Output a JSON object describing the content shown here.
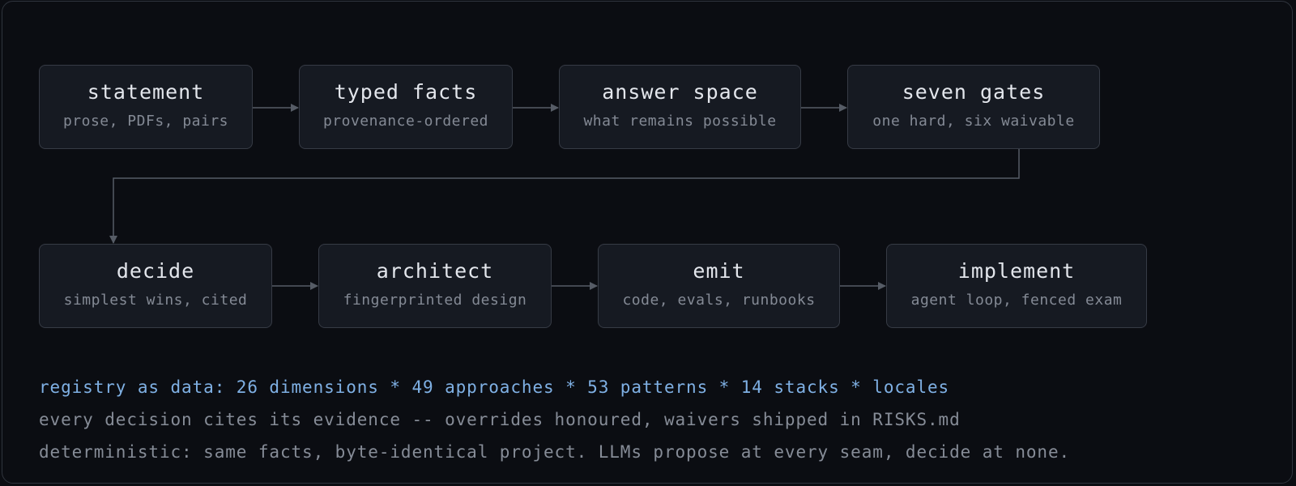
{
  "pipeline": {
    "row1": [
      {
        "title": "statement",
        "subtitle": "prose, PDFs, pairs"
      },
      {
        "title": "typed facts",
        "subtitle": "provenance-ordered"
      },
      {
        "title": "answer space",
        "subtitle": "what remains possible"
      },
      {
        "title": "seven gates",
        "subtitle": "one hard, six waivable"
      }
    ],
    "row2": [
      {
        "title": "decide",
        "subtitle": "simplest wins, cited"
      },
      {
        "title": "architect",
        "subtitle": "fingerprinted design"
      },
      {
        "title": "emit",
        "subtitle": "code, evals, runbooks"
      },
      {
        "title": "implement",
        "subtitle": "agent loop, fenced exam"
      }
    ]
  },
  "footer": {
    "registry": "registry as data: 26 dimensions * 49 approaches * 53 patterns * 14 stacks * locales",
    "evidence": "every decision cites its evidence -- overrides honoured, waivers shipped in RISKS.md",
    "determinism": "deterministic: same facts, byte-identical project. LLMs propose at every seam, decide at none."
  },
  "colors": {
    "background": "#0b0d12",
    "node_fill": "#161a22",
    "node_border": "#363b45",
    "connector": "#565c66",
    "highlight": "#7fb0e4"
  }
}
